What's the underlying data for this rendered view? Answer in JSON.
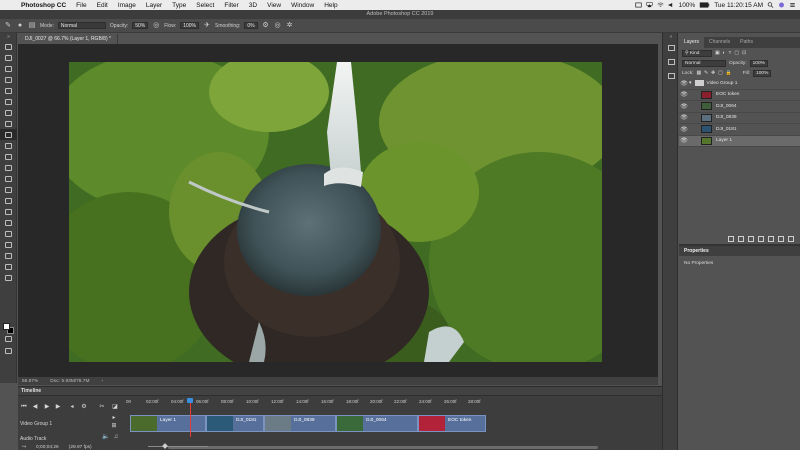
{
  "menubar": {
    "apple": "",
    "app": "Photoshop CC",
    "items": [
      "File",
      "Edit",
      "Image",
      "Layer",
      "Type",
      "Select",
      "Filter",
      "3D",
      "View",
      "Window",
      "Help"
    ],
    "battery": "100%",
    "clock": "Tue 11:20:15 AM"
  },
  "window_title": "Adobe Photoshop CC 2019",
  "options": {
    "mode_label": "Mode:",
    "mode_value": "Normal",
    "opacity_label": "Opacity:",
    "opacity_value": "50%",
    "flow_label": "Flow:",
    "flow_value": "100%",
    "smoothing_label": "Smoothing:",
    "smoothing_value": "0%"
  },
  "document": {
    "tab": "DJI_0027 @ 66.7% (Layer 1, RGB/8) *",
    "zoom": "66.67%",
    "doc_size": "Doc: 5.93M/78.7M"
  },
  "timeline": {
    "title": "Timeline",
    "ticks": [
      "00",
      "02:00f",
      "04:00f",
      "06:00f",
      "08:00f",
      "10:00f",
      "12:00f",
      "14:00f",
      "16:00f",
      "18:00f",
      "20:00f",
      "22:00f",
      "24:00f",
      "26:00f",
      "28:00f"
    ],
    "track_label": "Video Group 1",
    "clips": [
      {
        "name": "Layer 1"
      },
      {
        "name": "DJI_0181"
      },
      {
        "name": "DJI_0839"
      },
      {
        "name": "DJI_0064"
      },
      {
        "name": "EOC token"
      }
    ],
    "audio_label": "Audio Track",
    "timecode": "0;00;04;26",
    "fps": "(29.97 fps)"
  },
  "layers_panel": {
    "tabs": [
      "Layers",
      "Channels",
      "Paths"
    ],
    "filter_label": "Kind",
    "blend_mode": "Normal",
    "opacity_label": "Opacity:",
    "opacity_value": "100%",
    "lock_label": "Lock:",
    "fill_label": "Fill:",
    "fill_value": "100%",
    "group_name": "Video Group 1",
    "layers": [
      {
        "name": "EOC token"
      },
      {
        "name": "DJI_0064"
      },
      {
        "name": "DJI_0839"
      },
      {
        "name": "DJI_0181"
      },
      {
        "name": "Layer 1"
      }
    ]
  },
  "properties_panel": {
    "title": "Properties",
    "text": "No Properties"
  }
}
